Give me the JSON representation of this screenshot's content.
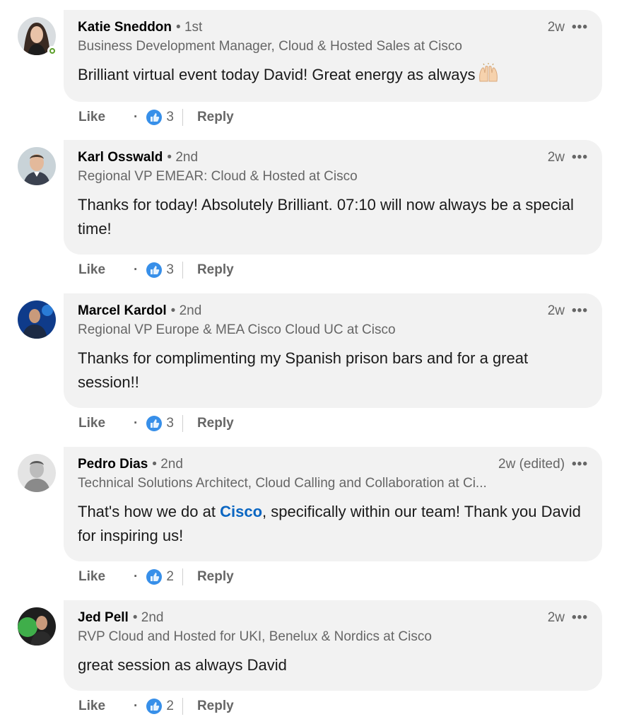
{
  "comments": [
    {
      "name": "Katie Sneddon",
      "degree": "• 1st",
      "time": "2w",
      "more": "•••",
      "headline": "Business Development Manager, Cloud & Hosted Sales at Cisco",
      "body_pre": "Brilliant virtual event today David! Great energy as always",
      "body_mention": "",
      "body_post": "",
      "emoji": "raising-hands-emoji",
      "like": "Like",
      "dot": "·",
      "reactions": "3",
      "reply": "Reply",
      "online": true
    },
    {
      "name": "Karl Osswald",
      "degree": "• 2nd",
      "time": "2w",
      "more": "•••",
      "headline": "Regional VP EMEAR: Cloud & Hosted at Cisco",
      "body_pre": "Thanks for today! Absolutely Brilliant. 07:10 will now always be a special time!",
      "body_mention": "",
      "body_post": "",
      "like": "Like",
      "dot": "·",
      "reactions": "3",
      "reply": "Reply"
    },
    {
      "name": "Marcel Kardol",
      "degree": "• 2nd",
      "time": "2w",
      "more": "•••",
      "headline": "Regional VP Europe & MEA Cisco Cloud UC at Cisco",
      "body_pre": "Thanks for complimenting my Spanish prison bars and for a great session!!",
      "body_mention": "",
      "body_post": "",
      "like": "Like",
      "dot": "·",
      "reactions": "3",
      "reply": "Reply"
    },
    {
      "name": "Pedro Dias",
      "degree": "• 2nd",
      "time": "2w (edited)",
      "more": "•••",
      "headline": "Technical Solutions Architect, Cloud Calling and Collaboration at Ci...",
      "body_pre": "That's how we do at ",
      "body_mention": "Cisco",
      "body_post": ", specifically within our team! Thank you David for inspiring us!",
      "like": "Like",
      "dot": "·",
      "reactions": "2",
      "reply": "Reply"
    },
    {
      "name": "Jed Pell",
      "degree": "• 2nd",
      "time": "2w",
      "more": "•••",
      "headline": "RVP Cloud and Hosted for UKI, Benelux & Nordics at Cisco",
      "body_pre": "great session as always David",
      "body_mention": "",
      "body_post": "",
      "like": "Like",
      "dot": "·",
      "reactions": "2",
      "reply": "Reply"
    }
  ],
  "colors": {
    "bubble": "#f2f2f2",
    "secondary_text": "#666666",
    "mention": "#0a66c2",
    "reaction_blue": "#378fe9",
    "presence_green": "#5b9e29"
  }
}
